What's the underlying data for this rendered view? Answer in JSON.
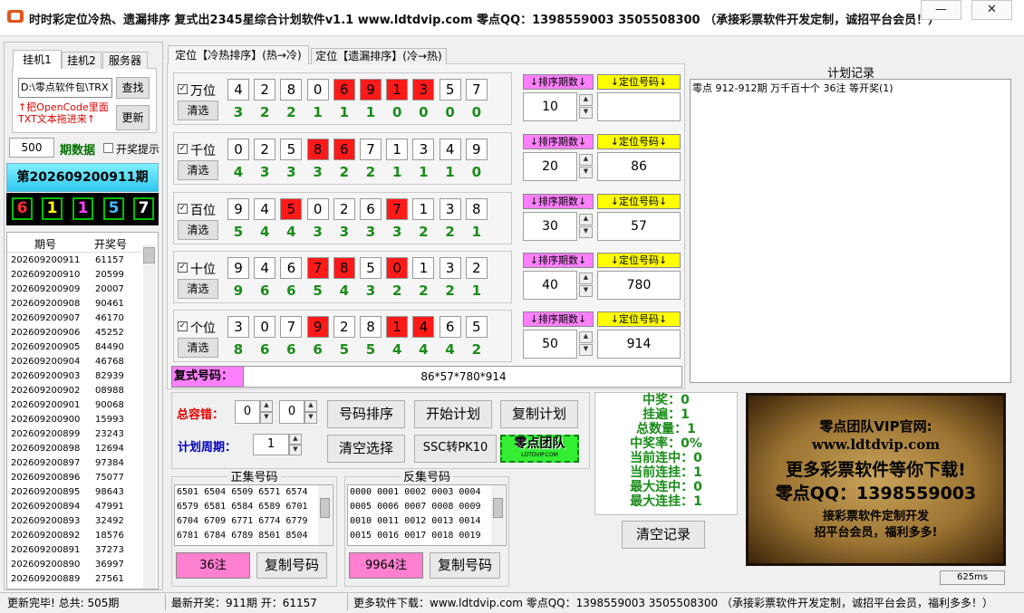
{
  "window": {
    "title": "时时彩定位冷热、遗漏排序 复式出2345星综合计划软件v1.1     www.ldtdvip.com     零点QQ：1398559003  3505508300  （承接彩票软件开发定制，诚招平台会员！）",
    "minimize": "—",
    "close": "✕"
  },
  "left_panel": {
    "tabs": [
      "挂机1",
      "挂机2",
      "服务器"
    ],
    "path_value": "D:\\零点软件包\\TRX",
    "find_button": "查找",
    "hint": "↑把OpenCode里面TXT文本拖进来↑",
    "refresh_button": "更新",
    "periods_value": "500",
    "periods_label": "期数据",
    "open_hint_label": "开奖提示",
    "issue_label": "第202609200911期",
    "balls": [
      {
        "value": "6",
        "color": "#ff3030"
      },
      {
        "value": "1",
        "color": "#ffff00"
      },
      {
        "value": "1",
        "color": "#ff40ff"
      },
      {
        "value": "5",
        "color": "#40c0ff"
      },
      {
        "value": "7",
        "color": "#ffffff"
      }
    ],
    "history_headers": [
      "期号",
      "开奖号"
    ],
    "history_rows": [
      [
        "202609200911",
        "61157"
      ],
      [
        "202609200910",
        "20599"
      ],
      [
        "202609200909",
        "20007"
      ],
      [
        "202609200908",
        "90461"
      ],
      [
        "202609200907",
        "46170"
      ],
      [
        "202609200906",
        "45252"
      ],
      [
        "202609200905",
        "84490"
      ],
      [
        "202609200904",
        "46768"
      ],
      [
        "202609200903",
        "82939"
      ],
      [
        "202609200902",
        "08988"
      ],
      [
        "202609200901",
        "90068"
      ],
      [
        "202609200900",
        "15993"
      ],
      [
        "202609200899",
        "23243"
      ],
      [
        "202609200898",
        "12694"
      ],
      [
        "202609200897",
        "97384"
      ],
      [
        "202609200896",
        "75077"
      ],
      [
        "202609200895",
        "98643"
      ],
      [
        "202609200894",
        "47991"
      ],
      [
        "202609200893",
        "32492"
      ],
      [
        "202609200892",
        "18576"
      ],
      [
        "202609200891",
        "37273"
      ],
      [
        "202609200890",
        "36997"
      ],
      [
        "202609200889",
        "27561"
      ]
    ]
  },
  "main_tabs": [
    "定位【冷热排序】(热→冷)",
    "定位【遗漏排序】(冷→热)"
  ],
  "positions": [
    {
      "label": "万位",
      "clear": "清选",
      "digits": [
        "4",
        "2",
        "8",
        "0",
        "6",
        "9",
        "1",
        "3",
        "5",
        "7"
      ],
      "red": [
        4,
        5,
        6,
        7
      ],
      "counts": [
        "3",
        "2",
        "2",
        "1",
        "1",
        "1",
        "0",
        "0",
        "0",
        "0"
      ],
      "sort_label": "↓排序期数↓",
      "sort_value": "10",
      "code_label": "↓定位号码↓",
      "code_value": ""
    },
    {
      "label": "千位",
      "clear": "清选",
      "digits": [
        "0",
        "2",
        "5",
        "8",
        "6",
        "7",
        "1",
        "3",
        "4",
        "9"
      ],
      "red": [
        3,
        4
      ],
      "counts": [
        "4",
        "3",
        "3",
        "3",
        "2",
        "2",
        "1",
        "1",
        "1",
        "0"
      ],
      "sort_label": "↓排序期数↓",
      "sort_value": "20",
      "code_label": "↓定位号码↓",
      "code_value": "86"
    },
    {
      "label": "百位",
      "clear": "清选",
      "digits": [
        "9",
        "4",
        "5",
        "0",
        "2",
        "6",
        "7",
        "1",
        "3",
        "8"
      ],
      "red": [
        2,
        6
      ],
      "counts": [
        "5",
        "4",
        "4",
        "3",
        "3",
        "3",
        "3",
        "2",
        "2",
        "1"
      ],
      "sort_label": "↓排序期数↓",
      "sort_value": "30",
      "code_label": "↓定位号码↓",
      "code_value": "57"
    },
    {
      "label": "十位",
      "clear": "清选",
      "digits": [
        "9",
        "4",
        "6",
        "7",
        "8",
        "5",
        "0",
        "1",
        "3",
        "2"
      ],
      "red": [
        3,
        4,
        6
      ],
      "counts": [
        "9",
        "6",
        "6",
        "5",
        "4",
        "3",
        "2",
        "2",
        "2",
        "1"
      ],
      "sort_label": "↓排序期数↓",
      "sort_value": "40",
      "code_label": "↓定位号码↓",
      "code_value": "780"
    },
    {
      "label": "个位",
      "clear": "清选",
      "digits": [
        "3",
        "0",
        "7",
        "9",
        "2",
        "8",
        "1",
        "4",
        "6",
        "5"
      ],
      "red": [
        3,
        6,
        7
      ],
      "counts": [
        "8",
        "6",
        "6",
        "6",
        "5",
        "5",
        "4",
        "4",
        "4",
        "2"
      ],
      "sort_label": "↓排序期数↓",
      "sort_value": "50",
      "code_label": "↓定位号码↓",
      "code_value": "914"
    }
  ],
  "compound": {
    "label": "复式号码：",
    "value": "86*57*780*914"
  },
  "plan_record": {
    "title": "计划记录",
    "text": "零点 912-912期 万千百十个 36注  等开奖(1)"
  },
  "controls": {
    "tolerance_label": "总容错：",
    "tol1": "0",
    "tol2": "0",
    "cycle_label": "计划周期：",
    "cycle_value": "1",
    "sort_btn": "号码排序",
    "start_btn": "开始计划",
    "copy_plan_btn": "复制计划",
    "clear_sel_btn": "清空选择",
    "ssc_btn": "SSC转PK10",
    "team_logo": "零点团队",
    "team_logo_url": "LDTDVIP.COM"
  },
  "stats": [
    "中奖：0",
    "挂遍：1",
    "总数量：1",
    "中奖率：0%",
    "当前连中：0",
    "当前连挂：1",
    "最大连中：0",
    "最大连挂：1"
  ],
  "clear_record_btn": "清空记录",
  "positive_set": {
    "title": "正集号码",
    "rows": [
      "6501 6504 6509 6571 6574",
      "6579 6581 6584 6589 6701",
      "6704 6709 6771 6774 6779",
      "6781 6784 6789 8501 8504"
    ],
    "count": "36注",
    "copy_btn": "复制号码"
  },
  "negative_set": {
    "title": "反集号码",
    "rows": [
      "0000 0001 0002 0003 0004",
      "0005 0006 0007 0008 0009",
      "0010 0011 0012 0013 0014",
      "0015 0016 0017 0018 0019"
    ],
    "count": "9964注",
    "copy_btn": "复制号码"
  },
  "ad": {
    "line1": "零点团队VIP官网:",
    "line2": "www.ldtdvip.com",
    "line3": "更多彩票软件等你下载!",
    "line4": "零点QQ：1398559003",
    "line5": "接彩票软件定制开发",
    "line6": "招平台会员，福利多多!"
  },
  "timer": "625ms",
  "status": {
    "left": "更新完毕! 总共: 505期",
    "mid": "最新开奖：911期 开：61157",
    "right": "更多软件下载：www.ldtdvip.com   零点QQ：1398559003  3505508300  （承接彩票软件开发定制，诚招平台会员，福利多多！）"
  }
}
